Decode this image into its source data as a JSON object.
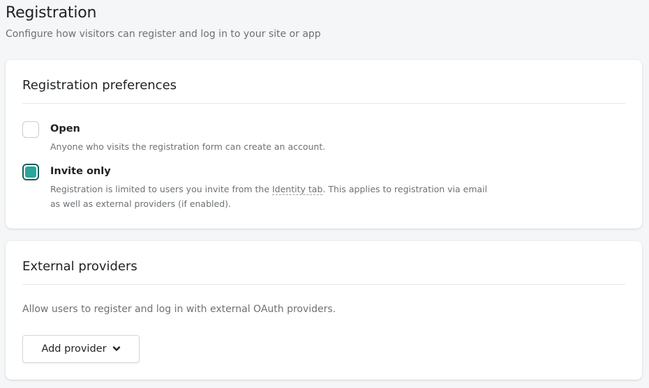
{
  "header": {
    "title": "Registration",
    "subtitle": "Configure how visitors can register and log in to your site or app"
  },
  "preferences": {
    "title": "Registration preferences",
    "options": [
      {
        "label": "Open",
        "description": "Anyone who visits the registration form can create an account.",
        "checked": false
      },
      {
        "label": "Invite only",
        "description_before": "Registration is limited to users you invite from the ",
        "description_link": "Identity tab",
        "description_after": ". This applies to registration via email as well as external providers (if enabled).",
        "checked": true
      }
    ]
  },
  "providers": {
    "title": "External providers",
    "description": "Allow users to register and log in with external OAuth providers.",
    "add_button_label": "Add provider",
    "add_button_icon": "chevron-down-icon"
  },
  "colors": {
    "accent": "#2aa69a",
    "accent_border": "#1a5f5a",
    "background": "#f4f6f7"
  }
}
